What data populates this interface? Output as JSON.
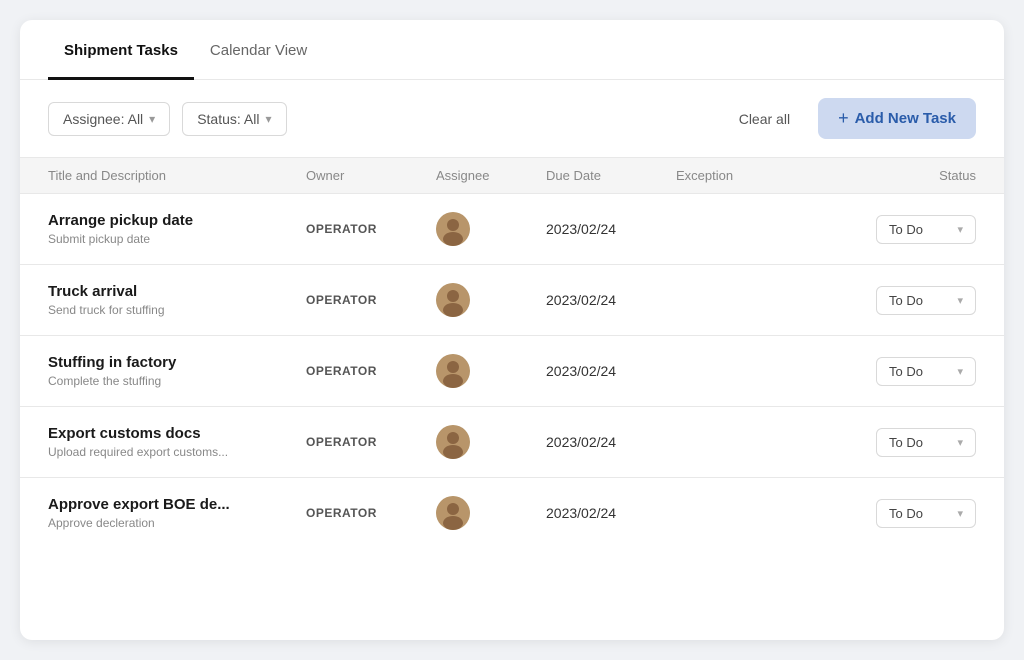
{
  "tabs": [
    {
      "id": "shipment-tasks",
      "label": "Shipment Tasks",
      "active": true
    },
    {
      "id": "calendar-view",
      "label": "Calendar View",
      "active": false
    }
  ],
  "toolbar": {
    "assignee_filter": "Assignee: All",
    "status_filter": "Status: All",
    "clear_label": "Clear all",
    "add_label": "Add New Task",
    "plus_icon": "+"
  },
  "table": {
    "headers": [
      {
        "id": "title",
        "label": "Title and Description"
      },
      {
        "id": "owner",
        "label": "Owner"
      },
      {
        "id": "assignee",
        "label": "Assignee"
      },
      {
        "id": "due_date",
        "label": "Due Date"
      },
      {
        "id": "exception",
        "label": "Exception"
      },
      {
        "id": "status",
        "label": "Status",
        "align": "right"
      }
    ],
    "rows": [
      {
        "id": 1,
        "title": "Arrange pickup date",
        "description": "Submit pickup date",
        "owner": "OPERATOR",
        "assignee_initial": "👤",
        "due_date": "2023/02/24",
        "exception": "",
        "status": "To Do"
      },
      {
        "id": 2,
        "title": "Truck arrival",
        "description": "Send truck for stuffing",
        "owner": "OPERATOR",
        "assignee_initial": "👤",
        "due_date": "2023/02/24",
        "exception": "",
        "status": "To Do"
      },
      {
        "id": 3,
        "title": "Stuffing in factory",
        "description": "Complete the stuffing",
        "owner": "OPERATOR",
        "assignee_initial": "👤",
        "due_date": "2023/02/24",
        "exception": "",
        "status": "To Do"
      },
      {
        "id": 4,
        "title": "Export customs docs",
        "description": "Upload required export customs...",
        "owner": "OPERATOR",
        "assignee_initial": "👤",
        "due_date": "2023/02/24",
        "exception": "",
        "status": "To Do"
      },
      {
        "id": 5,
        "title": "Approve export BOE de...",
        "description": "Approve decleration",
        "owner": "OPERATOR",
        "assignee_initial": "👤",
        "due_date": "2023/02/24",
        "exception": "",
        "status": "To Do"
      }
    ]
  }
}
